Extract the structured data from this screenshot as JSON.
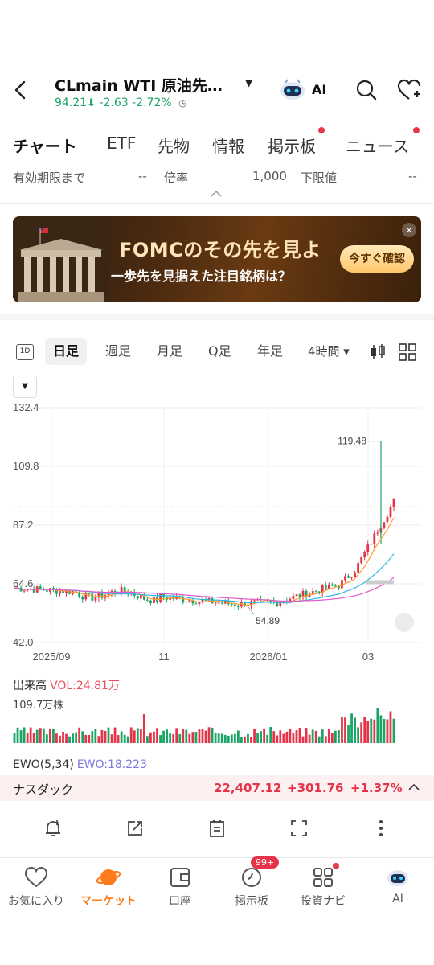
{
  "header": {
    "title": "CLmain  WTI 原油先…",
    "price": "94.21",
    "change": "-2.63",
    "change_pct": "-2.72%",
    "ai_label": "AI"
  },
  "tabs": [
    {
      "label": "チャート",
      "active": true
    },
    {
      "label": "ETF"
    },
    {
      "label": "先物"
    },
    {
      "label": "情報"
    },
    {
      "label": "掲示板",
      "dot": true
    },
    {
      "label": "ニュース",
      "dot": true
    }
  ],
  "info": {
    "expiry_label": "有効期限まで",
    "expiry_value": "--",
    "multiplier_label": "倍率",
    "multiplier_value": "1,000",
    "lower_limit_label": "下限値",
    "lower_limit_value": "--"
  },
  "banner": {
    "title": "FOMCのその先を見よ",
    "subtitle": "一歩先を見据えた注目銘柄は？",
    "button": "今すぐ確認",
    "close": "×"
  },
  "periods": {
    "oneday": "1D",
    "items": [
      "日足",
      "週足",
      "月足",
      "Q足",
      "年足",
      "4時間 ▾"
    ],
    "active_index": 0
  },
  "chart_data": {
    "type": "candlestick",
    "y_ticks": [
      "132.4",
      "109.8",
      "87.2",
      "64.6",
      "42.0"
    ],
    "ylim": [
      42.0,
      132.4
    ],
    "x_ticks": [
      "2025/09",
      "11",
      "2026/01",
      "03"
    ],
    "high_label": "119.48",
    "low_label": "54.89",
    "current_level": 94.21,
    "colors": {
      "up": "#e5344a",
      "down": "#1aa566",
      "ma1": "#ff9a2e",
      "ma2": "#2cb7e0",
      "ma3": "#e05ac8"
    }
  },
  "volume": {
    "title": "出来高",
    "value": "VOL:24.81万",
    "max": "109.7万株"
  },
  "ewo": {
    "title": "EWO(5,34)",
    "value": "EWO:18.223"
  },
  "nasdaq": {
    "name": "ナスダック",
    "value": "22,407.12",
    "change": "+301.76",
    "pct": "+1.37%"
  },
  "nav": {
    "items": [
      "お気に入り",
      "マーケット",
      "口座",
      "掲示板",
      "投資ナビ",
      "AI"
    ],
    "active_index": 1,
    "badge": "99+"
  }
}
